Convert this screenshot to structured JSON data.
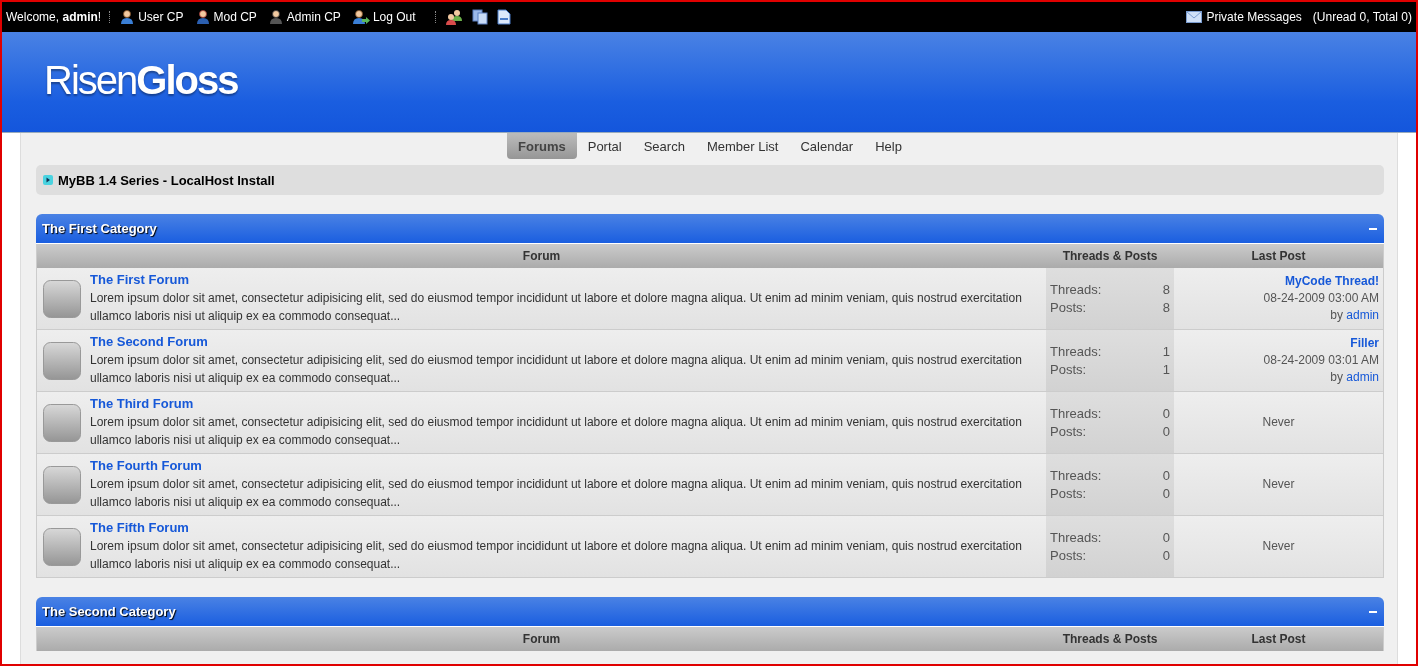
{
  "top_bar": {
    "welcome": "Welcome, **admin**!",
    "links": [
      {
        "label": "User CP",
        "kind": "user"
      },
      {
        "label": "Mod CP",
        "kind": "mod"
      },
      {
        "label": "Admin CP",
        "kind": "admin"
      },
      {
        "label": "Log Out",
        "kind": "logout"
      }
    ],
    "private_messages": "Private Messages",
    "pm_counts": "(Unread 0, Total 0)"
  },
  "logo": {
    "part_1": "Risen",
    "part_2": "Gloss"
  },
  "nav": [
    {
      "label": "Forums",
      "selected": true
    },
    {
      "label": "Portal",
      "selected": false
    },
    {
      "label": "Search",
      "selected": false
    },
    {
      "label": "Member List",
      "selected": false
    },
    {
      "label": "Calendar",
      "selected": false
    },
    {
      "label": "Help",
      "selected": false
    }
  ],
  "breadcrumb": "MyBB 1.4 Series - LocalHost Install",
  "categories": [
    {
      "title": "The First Category",
      "expanded": true,
      "columns": [
        "Forum",
        "Threads & Posts",
        "Last Post"
      ],
      "forums": [
        {
          "name": "The First Forum",
          "description": "Lorem ipsum dolor sit amet, consectetur adipisicing elit, sed do eiusmod tempor incididunt ut labore et dolore magna aliqua. Ut enim ad minim veniam, quis nostrud exercitation ullamco laboris nisi ut aliquip ex ea commodo consequat...",
          "threads_label": "Threads:",
          "threads": "8",
          "posts_label": "Posts:",
          "posts": "8",
          "last_post": {
            "kind": "post",
            "title": "MyCode Thread!",
            "date": "08-24-2009 03:00 AM",
            "by": "by",
            "author": "admin"
          }
        },
        {
          "name": "The Second Forum",
          "description": "Lorem ipsum dolor sit amet, consectetur adipisicing elit, sed do eiusmod tempor incididunt ut labore et dolore magna aliqua. Ut enim ad minim veniam, quis nostrud exercitation ullamco laboris nisi ut aliquip ex ea commodo consequat...",
          "threads_label": "Threads:",
          "threads": "1",
          "posts_label": "Posts:",
          "posts": "1",
          "last_post": {
            "kind": "post",
            "title": "Filler",
            "date": "08-24-2009 03:01 AM",
            "by": "by",
            "author": "admin"
          }
        },
        {
          "name": "The Third Forum",
          "description": "Lorem ipsum dolor sit amet, consectetur adipisicing elit, sed do eiusmod tempor incididunt ut labore et dolore magna aliqua. Ut enim ad minim veniam, quis nostrud exercitation ullamco laboris nisi ut aliquip ex ea commodo consequat...",
          "threads_label": "Threads:",
          "threads": "0",
          "posts_label": "Posts:",
          "posts": "0",
          "last_post": {
            "kind": "never",
            "text": "Never"
          }
        },
        {
          "name": "The Fourth Forum",
          "description": "Lorem ipsum dolor sit amet, consectetur adipisicing elit, sed do eiusmod tempor incididunt ut labore et dolore magna aliqua. Ut enim ad minim veniam, quis nostrud exercitation ullamco laboris nisi ut aliquip ex ea commodo consequat...",
          "threads_label": "Threads:",
          "threads": "0",
          "posts_label": "Posts:",
          "posts": "0",
          "last_post": {
            "kind": "never",
            "text": "Never"
          }
        },
        {
          "name": "The Fifth Forum",
          "description": "Lorem ipsum dolor sit amet, consectetur adipisicing elit, sed do eiusmod tempor incididunt ut labore et dolore magna aliqua. Ut enim ad minim veniam, quis nostrud exercitation ullamco laboris nisi ut aliquip ex ea commodo consequat...",
          "threads_label": "Threads:",
          "threads": "0",
          "posts_label": "Posts:",
          "posts": "0",
          "last_post": {
            "kind": "never",
            "text": "Never"
          }
        }
      ]
    },
    {
      "title": "The Second Category",
      "expanded": true,
      "columns": [
        "Forum",
        "Threads & Posts",
        "Last Post"
      ]
    }
  ]
}
